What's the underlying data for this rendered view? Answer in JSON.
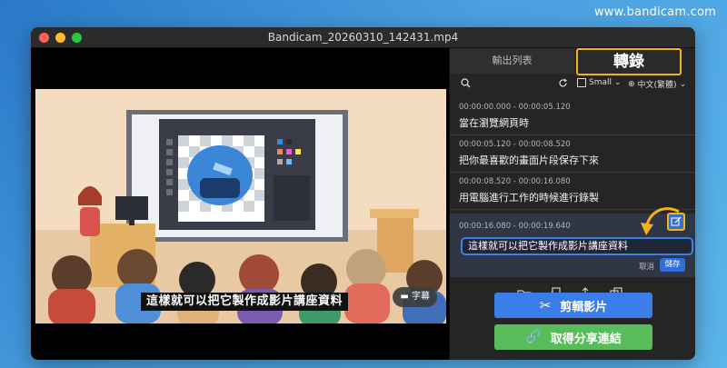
{
  "watermark": "www.bandicam.com",
  "window": {
    "title": "Bandicam_20260310_142431.mp4"
  },
  "video": {
    "subtitle": "這樣就可以把它製作成影片講座資料",
    "cc_label": "字幕"
  },
  "panel": {
    "tabs": [
      "輸出列表",
      "轉錄"
    ],
    "toolbar": {
      "size": "Small",
      "language": "中文(繁體)"
    },
    "entries": [
      {
        "time": "00:00:00.000 - 00:00:05.120",
        "text": "當在瀏覽網頁時"
      },
      {
        "time": "00:00:05.120 - 00:00:08.520",
        "text": "把你最喜歡的畫面片段保存下來"
      },
      {
        "time": "00:00:08.520 - 00:00:16.080",
        "text": "用電腦進行工作的時候進行錄製"
      },
      {
        "time": "00:00:16.080 - 00:00:19.640",
        "text": "這樣就可以把它製作成影片講座資料"
      }
    ],
    "cancel": "取消",
    "save": "儲存",
    "buttons": {
      "cut": "剪輯影片",
      "share": "取得分享連結"
    }
  },
  "colors": {
    "accent_blue": "#3a7ce8",
    "accent_green": "#57bd5a",
    "highlight": "#f2b21b"
  }
}
